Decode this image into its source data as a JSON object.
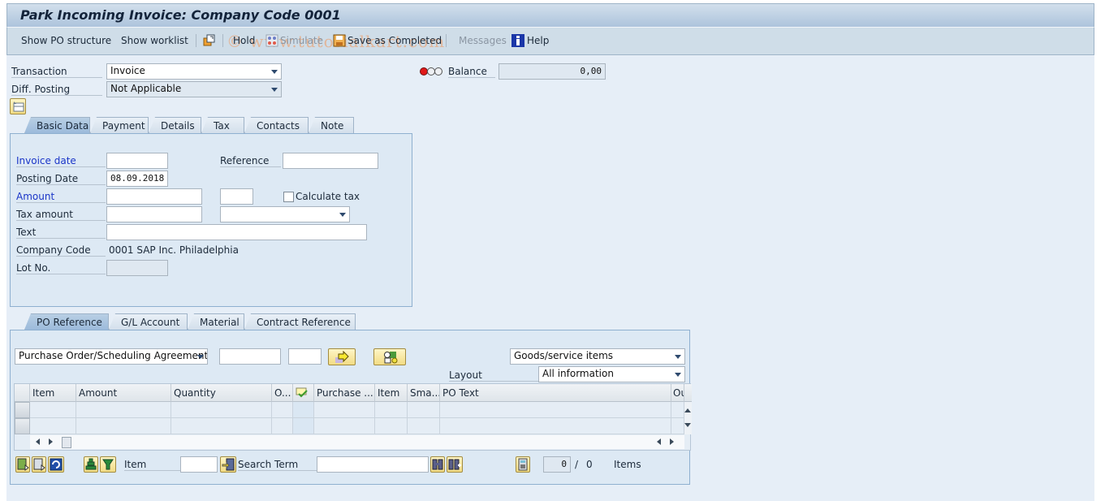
{
  "window": {
    "title": "Park Incoming Invoice: Company Code 0001",
    "watermark": "© www.tutorialkart.com"
  },
  "toolbar": {
    "show_po_structure": "Show PO structure",
    "show_worklist": "Show worklist",
    "hold": "Hold",
    "simulate": "Simulate",
    "save_as_completed": "Save as Completed",
    "messages": "Messages",
    "help": "Help"
  },
  "header": {
    "transaction_label": "Transaction",
    "transaction_value": "Invoice",
    "diff_posting_label": "Diff. Posting",
    "diff_posting_value": "Not Applicable",
    "balance_label": "Balance",
    "balance_value": "0,00",
    "balance_status": "red"
  },
  "upper_tabs": [
    {
      "label": "Basic Data",
      "active": true
    },
    {
      "label": "Payment",
      "active": false
    },
    {
      "label": "Details",
      "active": false
    },
    {
      "label": "Tax",
      "active": false
    },
    {
      "label": "Contacts",
      "active": false
    },
    {
      "label": "Note",
      "active": false
    }
  ],
  "basic_data": {
    "invoice_date_label": "Invoice date",
    "invoice_date_value": "",
    "reference_label": "Reference",
    "reference_value": "",
    "posting_date_label": "Posting Date",
    "posting_date_value": "08.09.2018",
    "amount_label": "Amount",
    "amount_value": "",
    "currency_value": "",
    "calculate_tax_label": "Calculate tax",
    "calculate_tax_checked": false,
    "tax_amount_label": "Tax amount",
    "tax_amount_value": "",
    "tax_code_value": "",
    "text_label": "Text",
    "text_value": "",
    "company_code_label": "Company Code",
    "company_code_value": "0001 SAP Inc. Philadelphia",
    "lot_no_label": "Lot No.",
    "lot_no_value": ""
  },
  "lower_tabs": [
    {
      "label": "PO Reference",
      "active": true
    },
    {
      "label": "G/L Account",
      "active": false
    },
    {
      "label": "Material",
      "active": false
    },
    {
      "label": "Contract Reference",
      "active": false
    }
  ],
  "po_reference": {
    "doc_type_value": "Purchase Order/Scheduling Agreement",
    "po_number_value": "",
    "po_item_value": "",
    "item_type_value": "Goods/service items",
    "layout_label": "Layout",
    "layout_value": "All information"
  },
  "grid": {
    "columns": [
      "Item",
      "Amount",
      "Quantity",
      "O...",
      "",
      "Purchase ...",
      "Item",
      "Sma...",
      "PO Text",
      "Ou"
    ],
    "rows": [
      [
        "",
        "",
        "",
        "",
        "",
        "",
        "",
        "",
        "",
        ""
      ],
      [
        "",
        "",
        "",
        "",
        "",
        "",
        "",
        "",
        "",
        ""
      ]
    ]
  },
  "footer": {
    "item_label": "Item",
    "item_value": "",
    "search_term_label": "Search Term",
    "search_term_value": "",
    "count_current": "0",
    "count_separator": "/",
    "count_total": "0",
    "items_label": "Items"
  }
}
